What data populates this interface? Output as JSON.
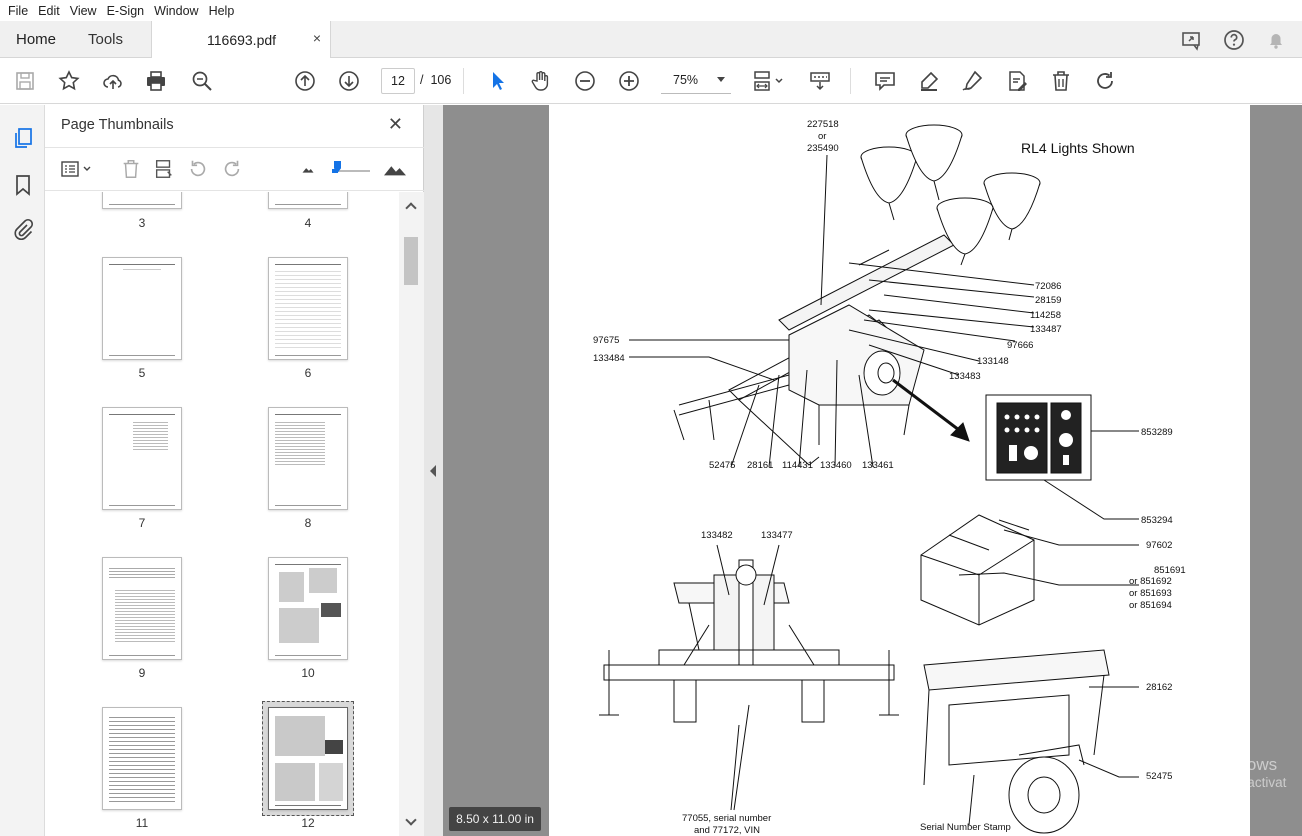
{
  "menu": [
    "File",
    "Edit",
    "View",
    "E-Sign",
    "Window",
    "Help"
  ],
  "tabs": {
    "home": "Home",
    "tools": "Tools",
    "document": "116693.pdf",
    "close": "×"
  },
  "toolbar": {
    "page_current": "12",
    "page_separator": "/",
    "page_total": "106",
    "zoom": "75%"
  },
  "panel": {
    "title": "Page Thumbnails",
    "close": "✕",
    "thumbnails": [
      {
        "label": "3"
      },
      {
        "label": "4"
      },
      {
        "label": "5"
      },
      {
        "label": "6"
      },
      {
        "label": "7"
      },
      {
        "label": "8"
      },
      {
        "label": "9"
      },
      {
        "label": "10"
      },
      {
        "label": "11"
      },
      {
        "label": "12",
        "selected": true
      }
    ]
  },
  "status": {
    "page_size": "8.50 x 11.00 in"
  },
  "watermark": {
    "line1": "Activate Windows",
    "line2": "Go to Settings to activat"
  },
  "drawing": {
    "title": "RL4 Lights Shown",
    "parts": {
      "p227518": "227518",
      "p_or": "or",
      "p235490": "235490",
      "p72086": "72086",
      "p28159": "28159",
      "p114258": "114258",
      "p133487": "133487",
      "p97666": "97666",
      "p133148": "133148",
      "p133483": "133483",
      "p97675": "97675",
      "p133484": "133484",
      "p52475a": "52475",
      "p28161": "28161",
      "p114431": "114431",
      "p133460": "133460",
      "p133461": "133461",
      "p853289": "853289",
      "p853294": "853294",
      "p133482": "133482",
      "p133477": "133477",
      "p97602": "97602",
      "p851691": "851691",
      "p851692": "or 851692",
      "p851693": "or 851693",
      "p851694": "or 851694",
      "p28162": "28162",
      "p52475b": "52475",
      "serial1": "77055, serial number",
      "serial2": "and 77172, VIN",
      "stamp": "Serial Number Stamp"
    }
  }
}
